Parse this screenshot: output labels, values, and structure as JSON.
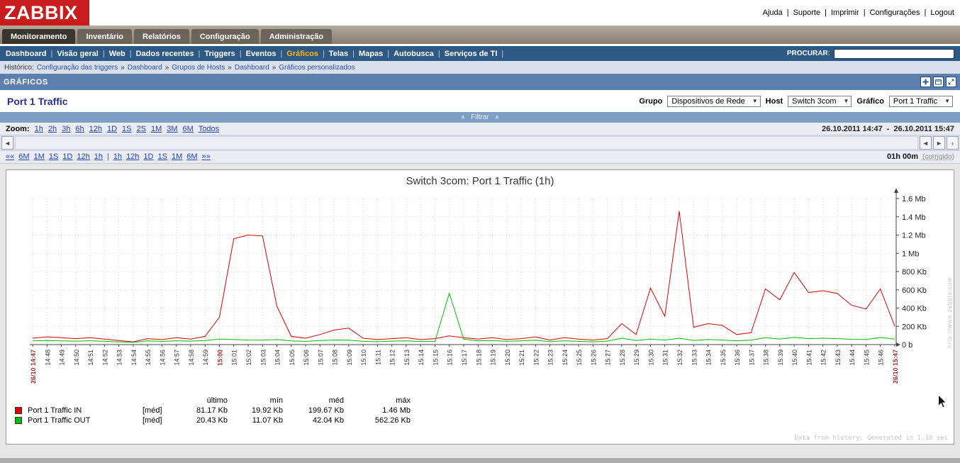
{
  "header": {
    "logo": "ZABBIX",
    "links": [
      "Ajuda",
      "Suporte",
      "Imprimir",
      "Configurações",
      "Logout"
    ]
  },
  "seps": {
    "pipe": "|",
    "raquo": "»",
    "dash": "-"
  },
  "icons": {
    "arrow_left": "◄",
    "arrow_right": "►",
    "angle_right": "›",
    "caret_up": "∧",
    "dropdown_arrow": "▼"
  },
  "main_nav": {
    "items": [
      {
        "label": "Monitoramento"
      },
      {
        "label": "Inventário"
      },
      {
        "label": "Relatórios"
      },
      {
        "label": "Configuração"
      },
      {
        "label": "Administração"
      }
    ]
  },
  "sub_nav": {
    "items": [
      "Dashboard",
      "Visão geral",
      "Web",
      "Dados recentes",
      "Triggers",
      "Eventos",
      "Gráficos",
      "Telas",
      "Mapas",
      "Autobusca",
      "Serviços de TI"
    ],
    "search_label": "PROCURAR:"
  },
  "history": {
    "label": "Histórico:",
    "items": [
      "Configuração das triggers",
      "Dashboard",
      "Grupos de Hosts",
      "Dashboard",
      "Gráficos personalizados"
    ]
  },
  "section": {
    "title": "GRÁFICOS"
  },
  "page": {
    "title": "Port 1 Traffic",
    "filter_toggle": "Filtrar",
    "controls": [
      {
        "label": "Grupo",
        "value": "Dispositivos de Rede"
      },
      {
        "label": "Host",
        "value": "Switch 3com"
      },
      {
        "label": "Gráfico",
        "value": "Port 1 Traffic"
      }
    ]
  },
  "zoom": {
    "label": "Zoom:",
    "options": [
      "1h",
      "2h",
      "3h",
      "6h",
      "12h",
      "1D",
      "1S",
      "2S",
      "1M",
      "3M",
      "6M",
      "Todos"
    ],
    "period_start": "26.10.2011 14:47",
    "period_end": "26.10.2011 15:47"
  },
  "timenav": {
    "prev_all": "««",
    "back": [
      "6M",
      "1M",
      "1S",
      "1D",
      "12h",
      "1h"
    ],
    "fwd": [
      "1h",
      "12h",
      "1D",
      "1S",
      "1M",
      "6M"
    ],
    "next_all": "»»",
    "duration": "01h 00m",
    "fixed": "(corrigido)"
  },
  "chart_data": {
    "type": "line",
    "title": "Switch 3com: Port 1 Traffic  (1h)",
    "unit_note": "values in Kb",
    "ylim": [
      0,
      1600
    ],
    "yticks": [
      {
        "label": "1.6 Mb",
        "value": 1600
      },
      {
        "label": "1.4 Mb",
        "value": 1400
      },
      {
        "label": "1.2 Mb",
        "value": 1200
      },
      {
        "label": "1 Mb",
        "value": 1000
      },
      {
        "label": "800 Kb",
        "value": 800
      },
      {
        "label": "600 Kb",
        "value": 600
      },
      {
        "label": "400 Kb",
        "value": 400
      },
      {
        "label": "200 Kb",
        "value": 200
      },
      {
        "label": "0 b",
        "value": 0
      }
    ],
    "x_labels": [
      "26/10 14:47",
      "14:48",
      "14:49",
      "14:50",
      "14:51",
      "14:52",
      "14:53",
      "14:54",
      "14:55",
      "14:56",
      "14:57",
      "14:58",
      "14:59",
      "15:00",
      "15:01",
      "15:02",
      "15:03",
      "15:04",
      "15:05",
      "15:06",
      "15:07",
      "15:08",
      "15:09",
      "15:10",
      "15:11",
      "15:12",
      "15:13",
      "15:14",
      "15:15",
      "15:16",
      "15:17",
      "15:18",
      "15:19",
      "15:20",
      "15:21",
      "15:22",
      "15:23",
      "15:24",
      "15:25",
      "15:26",
      "15:27",
      "15:28",
      "15:29",
      "15:30",
      "15:31",
      "15:32",
      "15:33",
      "15:34",
      "15:35",
      "15:36",
      "15:37",
      "15:38",
      "15:39",
      "15:40",
      "15:41",
      "15:42",
      "15:43",
      "15:44",
      "15:45",
      "15:46",
      "26/10 15:47"
    ],
    "red_label_indices": [
      0,
      13,
      60
    ],
    "series": [
      {
        "name": "Port 1 Traffic IN",
        "color": "#dd0000",
        "values": [
          70,
          85,
          75,
          65,
          75,
          60,
          45,
          30,
          65,
          55,
          75,
          60,
          90,
          300,
          1160,
          1200,
          1190,
          420,
          90,
          70,
          110,
          160,
          180,
          70,
          55,
          65,
          75,
          55,
          65,
          95,
          75,
          60,
          75,
          55,
          65,
          85,
          50,
          75,
          60,
          50,
          65,
          230,
          110,
          620,
          310,
          1460,
          190,
          230,
          210,
          110,
          130,
          610,
          490,
          790,
          570,
          590,
          560,
          430,
          390,
          610,
          200
        ]
      },
      {
        "name": "Port 1 Traffic OUT",
        "color": "#00bb00",
        "values": [
          40,
          45,
          40,
          38,
          42,
          36,
          30,
          25,
          40,
          35,
          42,
          38,
          45,
          60,
          55,
          50,
          48,
          55,
          40,
          35,
          45,
          50,
          48,
          36,
          32,
          38,
          40,
          34,
          36,
          562,
          60,
          40,
          44,
          36,
          40,
          48,
          32,
          42,
          36,
          30,
          38,
          70,
          45,
          60,
          50,
          70,
          45,
          55,
          50,
          42,
          48,
          75,
          60,
          80,
          65,
          70,
          65,
          58,
          55,
          78,
          60
        ]
      }
    ]
  },
  "legend": {
    "headers": [
      "último",
      "mín",
      "méd",
      "máx"
    ],
    "rows": [
      {
        "name": "Port 1 Traffic IN",
        "agg": "[méd]",
        "values": [
          "81.17 Kb",
          "19.92 Kb",
          "199.67 Kb",
          "1.46 Mb"
        ]
      },
      {
        "name": "Port 1 Traffic OUT",
        "agg": "[méd]",
        "values": [
          "20.43 Kb",
          "11.07 Kb",
          "42.04 Kb",
          "562.26 Kb"
        ]
      }
    ]
  },
  "footer": {
    "note": "Data from history. Generated in 1.18 sec"
  },
  "watermark": "http://www.zabbix.com"
}
